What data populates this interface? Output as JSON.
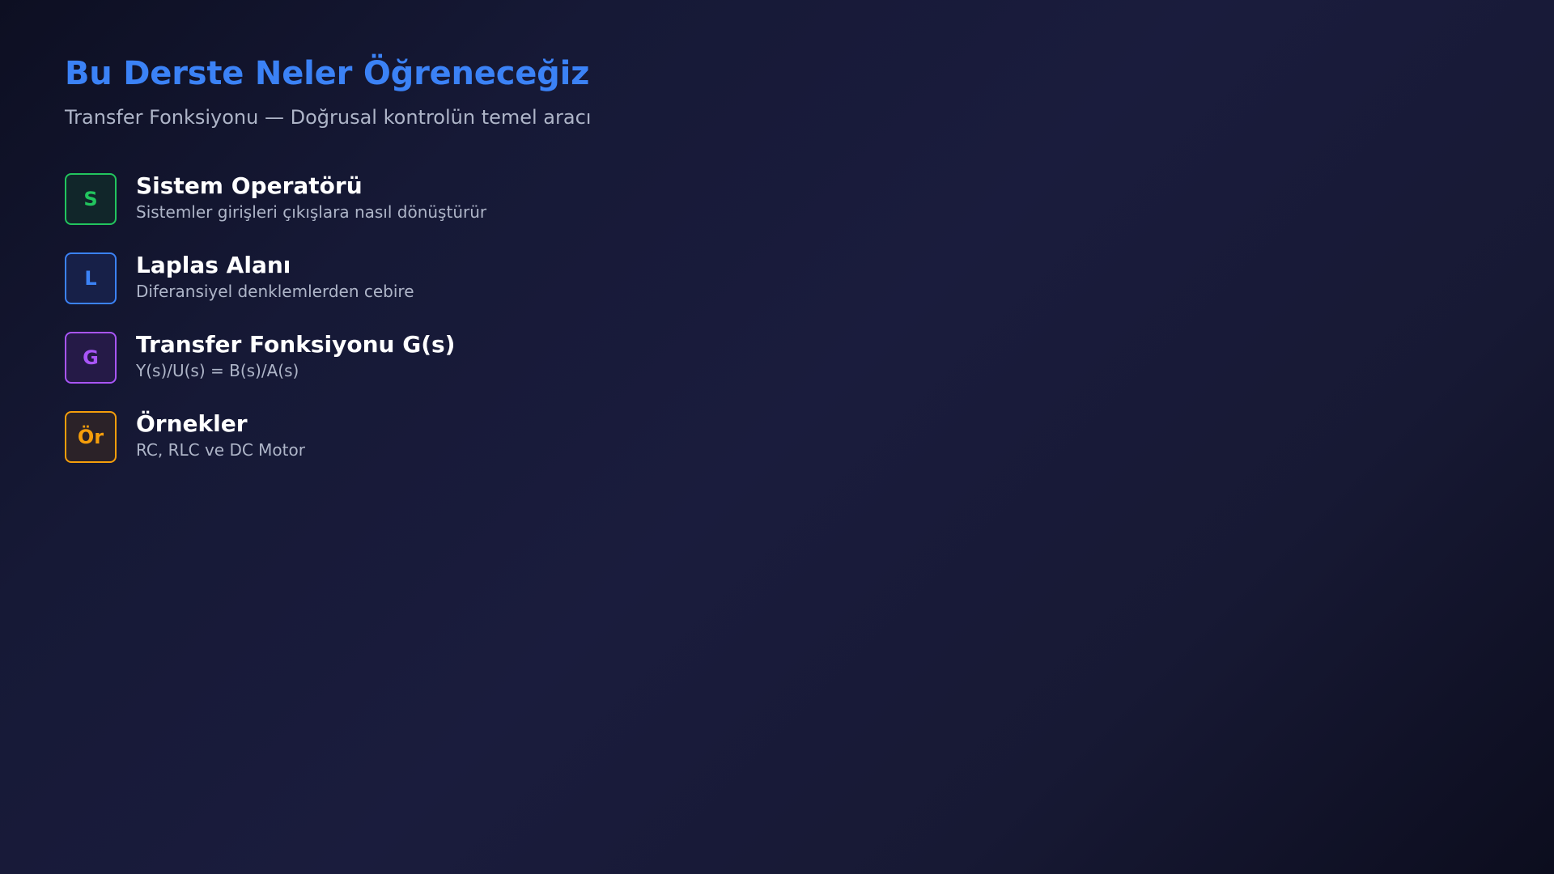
{
  "slide": {
    "title": "Bu Derste Neler Öğreneceğiz",
    "subtitle": "Transfer Fonksiyonu — Doğrusal kontrolün temel aracı",
    "title_color": "#3b82f6",
    "items": [
      {
        "badge": "S",
        "title": "Sistem Operatörü",
        "description": "Sistemler girişleri çıkışlara nasıl dönüştürür",
        "color": "#22c55e",
        "bg": "#11262a"
      },
      {
        "badge": "L",
        "title": "Laplas Alanı",
        "description": "Diferansiyel denklemlerden cebire",
        "color": "#3b82f6",
        "bg": "#172048"
      },
      {
        "badge": "G",
        "title": "Transfer Fonksiyonu G(s)",
        "description": "Y(s)/U(s) = B(s)/A(s)",
        "color": "#a855f7",
        "bg": "#251a47"
      },
      {
        "badge": "Ör",
        "title": "Örnekler",
        "description": "RC, RLC ve DC Motor",
        "color": "#f59e0b",
        "bg": "#2b2228"
      }
    ]
  }
}
